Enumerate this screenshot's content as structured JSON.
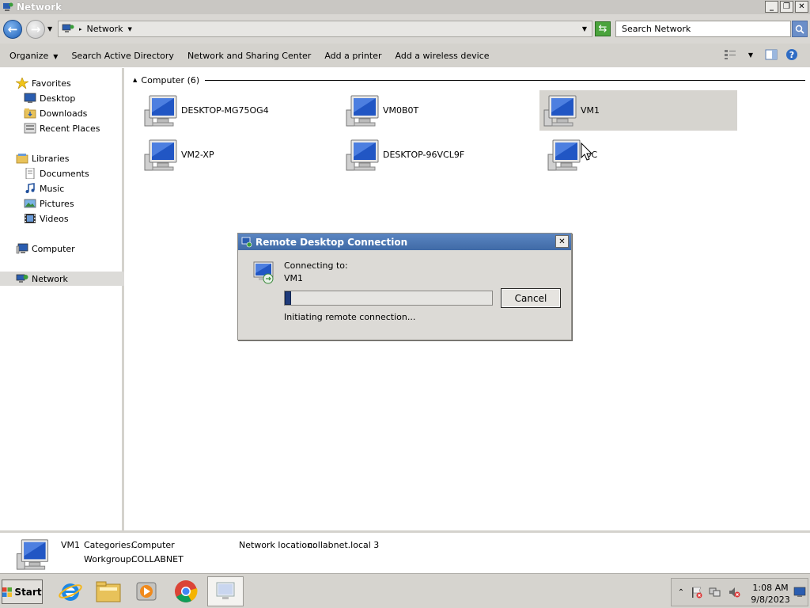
{
  "window": {
    "title": "Network"
  },
  "address": {
    "crumb": "Network",
    "search_placeholder": "Search Network"
  },
  "toolbar": {
    "items": [
      {
        "label": "Organize",
        "dropdown": true
      },
      {
        "label": "Search Active Directory"
      },
      {
        "label": "Network and Sharing Center"
      },
      {
        "label": "Add a printer"
      },
      {
        "label": "Add a wireless device"
      }
    ]
  },
  "nav": {
    "favorites": "Favorites",
    "desktop": "Desktop",
    "downloads": "Downloads",
    "recent": "Recent Places",
    "libraries": "Libraries",
    "documents": "Documents",
    "music": "Music",
    "pictures": "Pictures",
    "videos": "Videos",
    "computer": "Computer",
    "network": "Network"
  },
  "content": {
    "group_header": "Computer (6)",
    "computers": [
      {
        "name": "DESKTOP-MG75OG4"
      },
      {
        "name": "VM0B0T"
      },
      {
        "name": "VM1",
        "selected": true
      },
      {
        "name": "VM2-XP"
      },
      {
        "name": "DESKTOP-96VCL9F"
      },
      {
        "name": "DC"
      }
    ]
  },
  "details": {
    "name": "VM1",
    "categories_label": "Categories:",
    "categories_value": "Computer",
    "workgroup_label": "Workgroup:",
    "workgroup_value": "COLLABNET",
    "location_label": "Network location:",
    "location_value": "collabnet.local  3"
  },
  "dialog": {
    "title": "Remote Desktop Connection",
    "connecting_label": "Connecting to:",
    "target": "VM1",
    "status": "Initiating remote connection...",
    "cancel": "Cancel",
    "progress": 0.03
  },
  "taskbar": {
    "start": "Start",
    "time": "1:08 AM",
    "date": "9/8/2023"
  },
  "colors": {
    "selection": "#d6d4cf",
    "dialog_title": "#4a77b4",
    "progress_fill": "#1e3a7a"
  }
}
